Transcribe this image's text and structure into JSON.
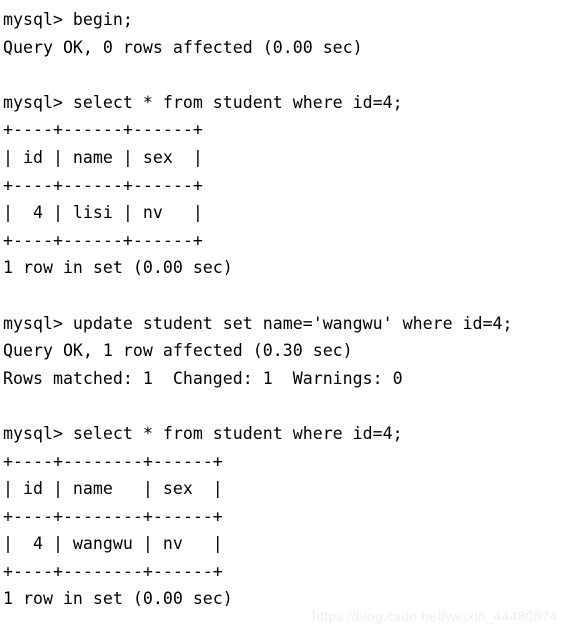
{
  "terminal": {
    "background_color": "#ffffff",
    "text_color": "#000000",
    "prompt": "mysql>",
    "lines": [
      "mysql> begin;",
      "Query OK, 0 rows affected (0.00 sec)",
      "",
      "mysql> select * from student where id=4;",
      "+----+------+------+",
      "| id | name | sex  |",
      "+----+------+------+",
      "|  4 | lisi | nv   |",
      "+----+------+------+",
      "1 row in set (0.00 sec)",
      "",
      "mysql> update student set name='wangwu' where id=4;",
      "Query OK, 1 row affected (0.30 sec)",
      "Rows matched: 1  Changed: 1  Warnings: 0",
      "",
      "mysql> select * from student where id=4;",
      "+----+--------+------+",
      "| id | name   | sex  |",
      "+----+--------+------+",
      "|  4 | wangwu | nv   |",
      "+----+--------+------+",
      "1 row in set (0.00 sec)"
    ]
  },
  "statements": [
    {
      "command": "begin;",
      "result": "Query OK, 0 rows affected (0.00 sec)",
      "rows_affected": 0,
      "duration_sec": "0.00"
    },
    {
      "command": "select * from student where id=4;",
      "result": "1 row in set (0.00 sec)",
      "row_count": 1,
      "duration_sec": "0.00",
      "table": {
        "columns": [
          "id",
          "name",
          "sex"
        ],
        "rows": [
          [
            "4",
            "lisi",
            "nv"
          ]
        ]
      }
    },
    {
      "command": "update student set name='wangwu' where id=4;",
      "result": "Query OK, 1 row affected (0.30 sec)",
      "detail": "Rows matched: 1  Changed: 1  Warnings: 0",
      "rows_affected": 1,
      "rows_matched": 1,
      "changed": 1,
      "warnings": 0,
      "duration_sec": "0.30"
    },
    {
      "command": "select * from student where id=4;",
      "result": "1 row in set (0.00 sec)",
      "row_count": 1,
      "duration_sec": "0.00",
      "table": {
        "columns": [
          "id",
          "name",
          "sex"
        ],
        "rows": [
          [
            "4",
            "wangwu",
            "nv"
          ]
        ]
      }
    }
  ],
  "watermark": {
    "text": "https://blog.csdn.net/weixin_44480874",
    "color": "#eceff1"
  }
}
